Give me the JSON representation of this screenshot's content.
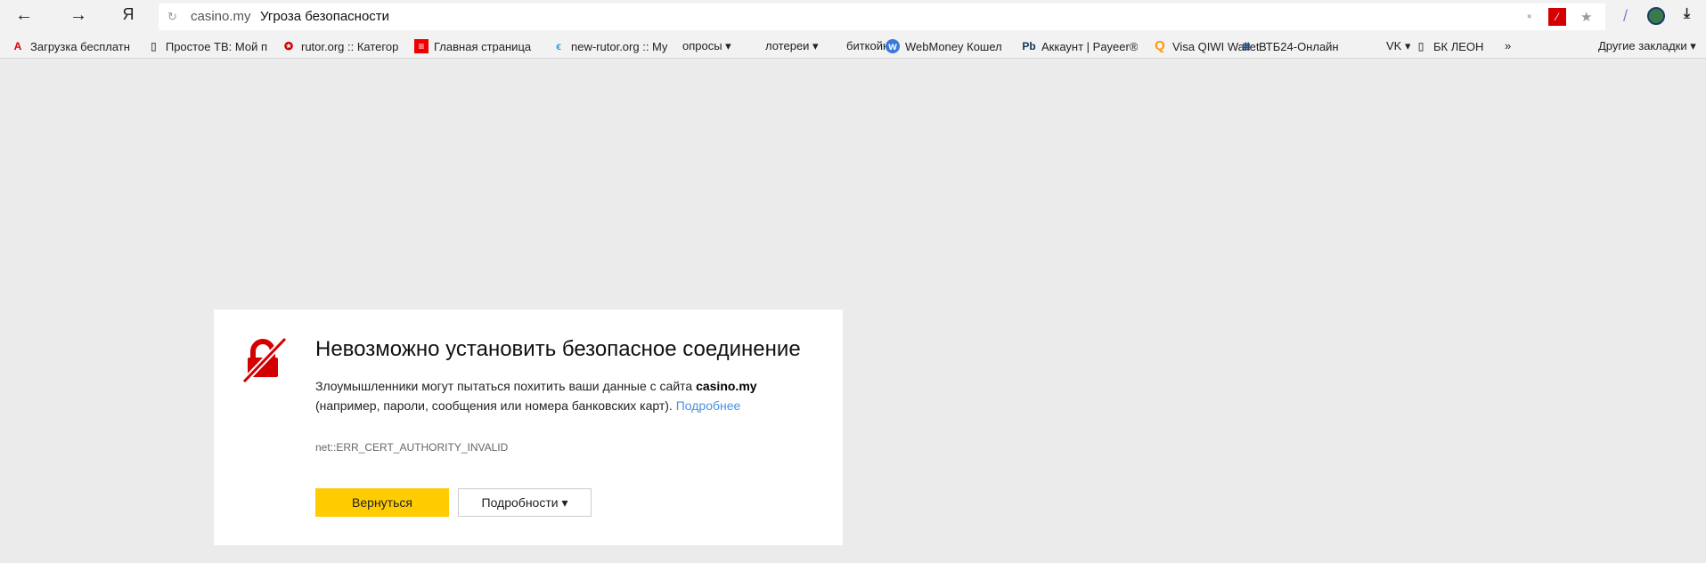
{
  "toolbar": {
    "back": "←",
    "forward": "→",
    "yandex": "Я",
    "reload": "↻",
    "host": "casino.my",
    "title": "Угроза безопасности"
  },
  "bookmarks": [
    "Загрузка бесплатн",
    "Простое ТВ: Мой п",
    "rutor.org :: Категор",
    "Главная страница",
    "new-rutor.org :: My",
    "опросы ▾",
    "лотереи ▾",
    "биткойн ▾",
    "WebMoney Кошел",
    "Аккаунт | Payeer®",
    "Visa QIWI Wallet",
    "ВТБ24-Онлайн",
    "VK ▾",
    "БК ЛЕОН",
    "»",
    "Другие закладки ▾"
  ],
  "error": {
    "title": "Невозможно установить безопасное соединение",
    "line1": "Злоумышленники могут пытаться похитить ваши данные с сайта ",
    "site": "casino.my",
    "line2": "(например, пароли, сообщения или номера банковских карт). ",
    "more_link": "Подробнее",
    "code": "net::ERR_CERT_AUTHORITY_INVALID",
    "back_button": "Вернуться",
    "details_button": "Подробности ▾"
  },
  "colors": {
    "accent": "#ffcc00",
    "danger": "#d40000",
    "link": "#4b8fe0"
  }
}
